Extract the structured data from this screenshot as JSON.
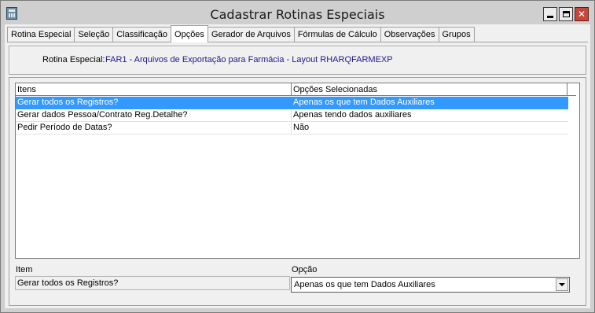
{
  "window": {
    "title": "Cadastrar Rotinas Especiais"
  },
  "tabs": [
    {
      "label": "Rotina Especial",
      "active": false
    },
    {
      "label": "Seleção",
      "active": false
    },
    {
      "label": "Classificação",
      "active": false
    },
    {
      "label": "Opções",
      "active": true
    },
    {
      "label": "Gerador de Arquivos",
      "active": false
    },
    {
      "label": "Fórmulas de Cálculo",
      "active": false
    },
    {
      "label": "Observações",
      "active": false
    },
    {
      "label": "Grupos",
      "active": false
    }
  ],
  "info": {
    "label": "Rotina Especial:",
    "value": "FAR1 - Arquivos de Exportação para Farmácia - Layout RHARQFARMEXP",
    "value_color": "#1a1a8c"
  },
  "list": {
    "columns": [
      "Itens",
      "Opções Selecionadas"
    ],
    "rows": [
      {
        "item": "Gerar todos os Registros?",
        "option": "Apenas os que tem Dados Auxiliares",
        "selected": true
      },
      {
        "item": "Gerar dados Pessoa/Contrato Reg.Detalhe?",
        "option": "Apenas tendo dados auxiliares",
        "selected": false
      },
      {
        "item": "Pedir Período de Datas?",
        "option": "Não",
        "selected": false
      }
    ],
    "selection_color": "#3399ff"
  },
  "detail": {
    "item_label": "Item",
    "item_value": "Gerar todos os Registros?",
    "option_label": "Opção",
    "option_value": "Apenas os que tem Dados Auxiliares"
  },
  "icons": {
    "app": "app-grid-icon",
    "minimize": "minimize-icon",
    "maximize": "maximize-icon",
    "close": "close-icon",
    "dropdown": "chevron-down-icon"
  }
}
